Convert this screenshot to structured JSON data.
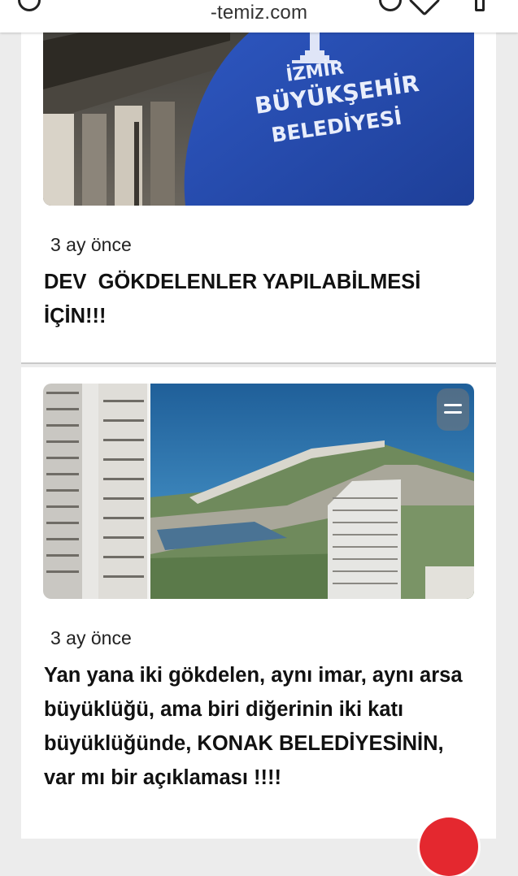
{
  "browser": {
    "url": "-temiz.com"
  },
  "posts": [
    {
      "time": "3 ay önce",
      "title": "DEV  GÖKDELENLER YAPILABİLMESİ İÇİN!!!",
      "image_text": {
        "line1": "İZMİR",
        "line2": "BÜYÜKŞEHİR",
        "line3": "BELEDİYESİ"
      },
      "colors": {
        "banner": "#2a4fb5",
        "building": "#5a5650"
      }
    },
    {
      "time": "3 ay önce",
      "title": "Yan yana iki gökdelen, aynı imar, aynı arsa büyüklüğü, ama biri diğerinin iki katı büyüklüğünde, KONAK BELEDİYESİNİN, var mı bir açıklaması !!!!",
      "colors": {
        "sea": "#2c6fa8",
        "land": "#6f8a5c"
      }
    }
  ],
  "icons": {
    "menu_handle": "menu-icon",
    "fab": "red-action-icon"
  }
}
